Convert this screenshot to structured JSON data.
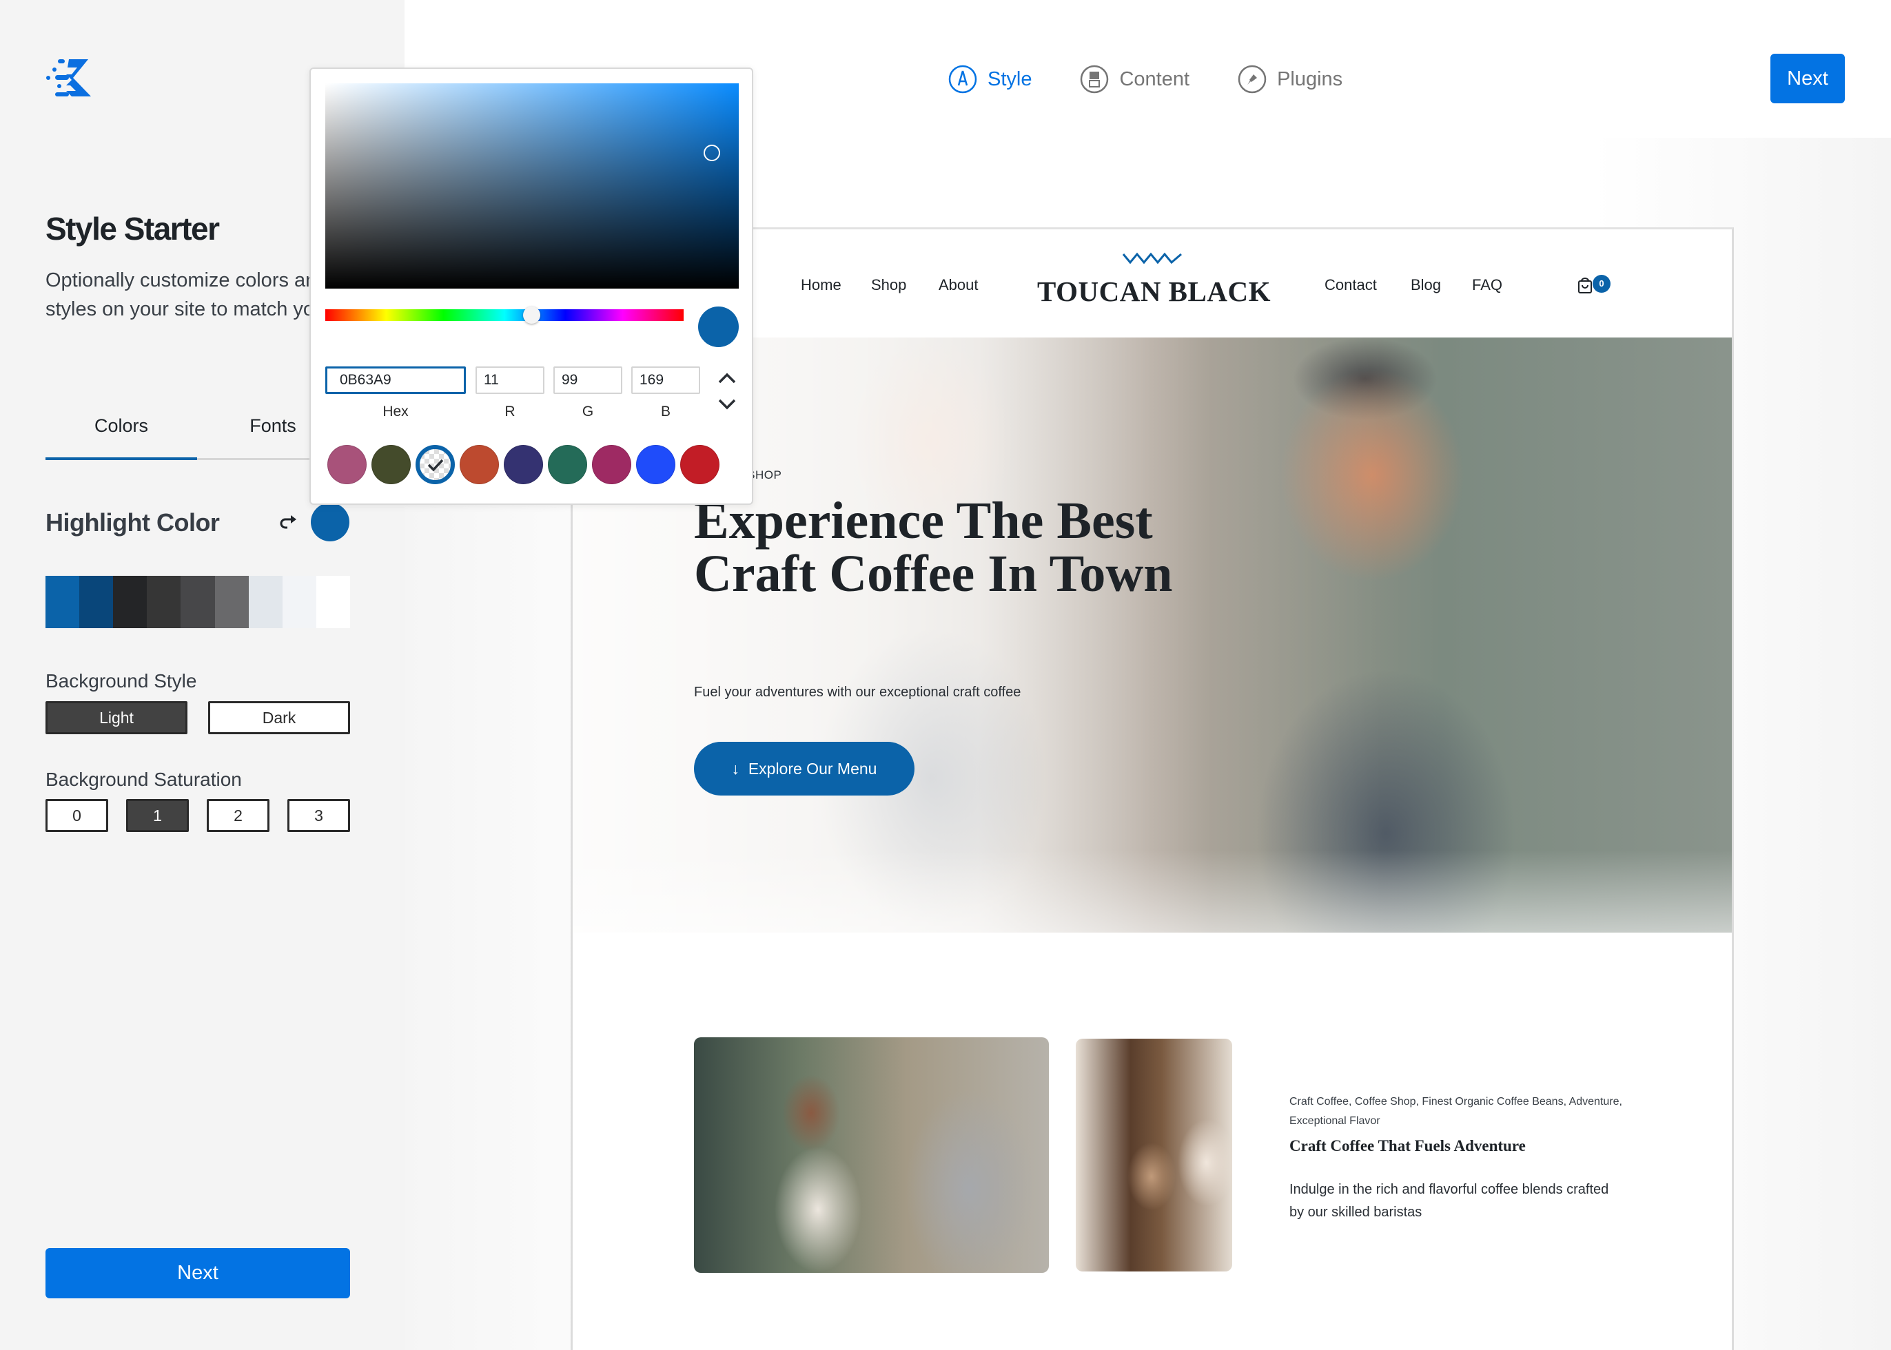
{
  "sidebar": {
    "title": "Style Starter",
    "description": "Optionally customize colors and font styles on your site to match your brand.",
    "tabs": [
      {
        "label": "Colors",
        "active": true
      },
      {
        "label": "Fonts",
        "active": false
      }
    ],
    "highlight": {
      "label": "Highlight Color",
      "value": "#0B63A9",
      "reset_icon": "redo-arrow-icon"
    },
    "palette": [
      "#0b63a9",
      "#09467a",
      "#242527",
      "#363636",
      "#474749",
      "#69696b",
      "#e2e7ec",
      "#f2f4f7",
      "#ffffff"
    ],
    "background_style": {
      "label": "Background Style",
      "options": [
        "Light",
        "Dark"
      ],
      "selected": "Light"
    },
    "background_saturation": {
      "label": "Background Saturation",
      "options": [
        "0",
        "1",
        "2",
        "3"
      ],
      "selected": "1"
    },
    "next_label": "Next"
  },
  "stepper": {
    "steps": [
      {
        "label": "Style",
        "icon": "style-pen-icon",
        "active": true
      },
      {
        "label": "Content",
        "icon": "content-layout-icon",
        "active": false
      },
      {
        "label": "Plugins",
        "icon": "plugin-plug-icon",
        "active": false
      }
    ],
    "next_label": "Next"
  },
  "color_picker": {
    "hex": "0B63A9",
    "r": "11",
    "g": "99",
    "b": "169",
    "labels": {
      "hex": "Hex",
      "r": "R",
      "g": "G",
      "b": "B"
    },
    "current_color": "#0b63a9",
    "hue_fraction": 0.575,
    "saturation_fraction": 0.935,
    "value_fraction": 0.66,
    "presets": [
      {
        "color": "#a8527a",
        "selected": false
      },
      {
        "color": "#444b2b",
        "selected": false
      },
      {
        "color": "transparent",
        "selected": true
      },
      {
        "color": "#bd4a2f",
        "selected": false
      },
      {
        "color": "#343271",
        "selected": false
      },
      {
        "color": "#246b58",
        "selected": false
      },
      {
        "color": "#9e2a63",
        "selected": false
      },
      {
        "color": "#1f4cfa",
        "selected": false
      },
      {
        "color": "#c21d26",
        "selected": false
      }
    ]
  },
  "site_preview": {
    "nav_left": [
      "Home",
      "Shop",
      "About"
    ],
    "brand": "TOUCAN BLACK",
    "nav_right": [
      "Contact",
      "Blog",
      "FAQ"
    ],
    "cart_count": "0",
    "hero": {
      "eyebrow": "COFFEE SHOP",
      "eyebrow_visible": "FFEE SHOP",
      "title": "Experience The Best Craft Coffee In Town",
      "subtitle": "Fuel your adventures with our exceptional craft coffee",
      "button_label": "Explore Our Menu"
    },
    "feature": {
      "tags": "Craft Coffee, Coffee Shop, Finest Organic Coffee Beans, Adventure, Exceptional Flavor",
      "title": "Craft Coffee That Fuels Adventure",
      "body": "Indulge in the rich and flavorful coffee blends crafted by our skilled baristas"
    }
  },
  "colors": {
    "accent": "#0373e3",
    "highlight": "#0b63a9",
    "sidebar_bg": "#f4f4f4"
  }
}
